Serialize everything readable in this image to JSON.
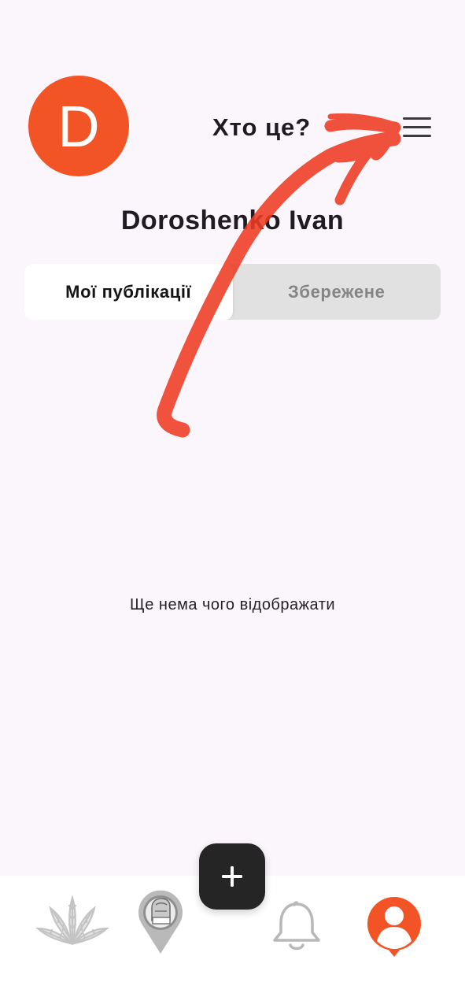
{
  "profile": {
    "avatar_letter": "D",
    "avatar_color": "#f35426",
    "name": "Doroshenko Ivan"
  },
  "header": {
    "title": "Хто це?",
    "menu_icon": "hamburger-menu-icon"
  },
  "tabs": [
    {
      "label": "Мої публікації",
      "active": true
    },
    {
      "label": "Збережене",
      "active": false
    }
  ],
  "content": {
    "empty_message": "Ще нема чого відображати"
  },
  "bottom_nav": {
    "items": [
      {
        "icon": "chestnut-leaf-icon",
        "active": false
      },
      {
        "icon": "map-pin-glove-icon",
        "active": false
      },
      {
        "icon": "bell-icon",
        "active": false
      },
      {
        "icon": "profile-icon",
        "active": true
      }
    ],
    "add_icon": "plus-icon"
  },
  "colors": {
    "accent": "#f35426",
    "annotation": "#ee3b22",
    "background": "#fbf6fb",
    "inactive_icon": "#b5b5b5"
  }
}
